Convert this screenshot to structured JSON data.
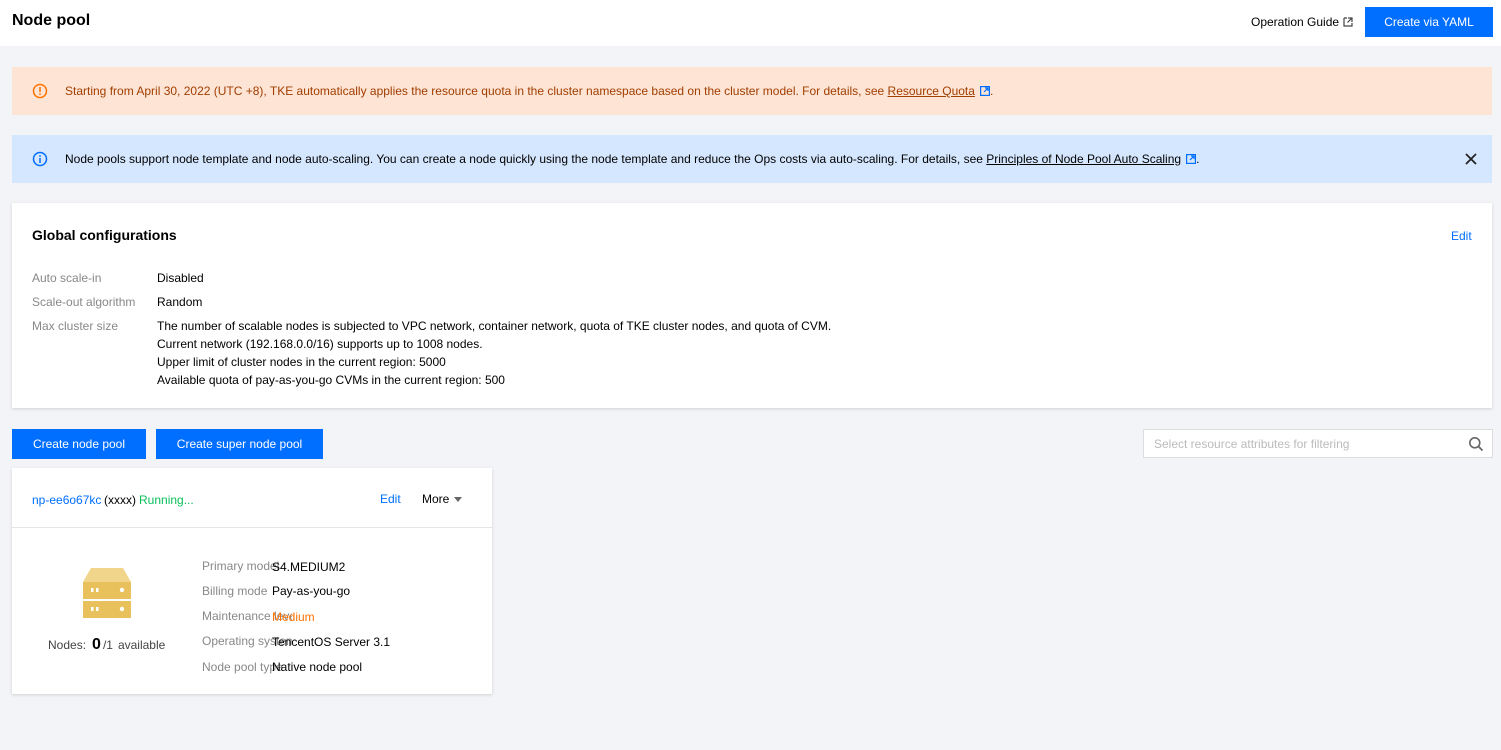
{
  "header": {
    "title": "Node pool",
    "operation_guide": "Operation Guide",
    "create_yaml": "Create via YAML"
  },
  "alerts": {
    "warning": {
      "text": "Starting from April 30, 2022 (UTC +8), TKE automatically applies the resource quota in the cluster namespace based on the cluster model. For details, see ",
      "link": "Resource Quota",
      "suffix": "."
    },
    "info": {
      "text": "Node pools support node template and node auto-scaling. You can create a node quickly using the node template and reduce the Ops costs via auto-scaling. For details, see ",
      "link": "Principles of Node Pool Auto Scaling",
      "suffix": "."
    }
  },
  "global_config": {
    "title": "Global configurations",
    "edit": "Edit",
    "items": [
      {
        "label": "Auto scale-in",
        "value": [
          "Disabled"
        ]
      },
      {
        "label": "Scale-out algorithm",
        "value": [
          "Random"
        ]
      },
      {
        "label": "Max cluster size",
        "value": [
          "The number of scalable nodes is subjected to VPC network, container network, quota of TKE cluster nodes, and quota of CVM.",
          "Current network (192.168.0.0/16) supports up to 1008 nodes.",
          "Upper limit of cluster nodes in the current region: 5000",
          "Available quota of pay-as-you-go CVMs in the current region: 500"
        ]
      }
    ]
  },
  "actions": {
    "create_node_pool": "Create node pool",
    "create_super_node_pool": "Create super node pool",
    "filter_placeholder": "Select resource attributes for filtering"
  },
  "node_pool": {
    "id": "np-ee6o67kc",
    "alias": "(xxxx)",
    "status": "Running...",
    "edit": "Edit",
    "more": "More",
    "nodes_label": "Nodes:",
    "nodes_count": "0",
    "nodes_total": "/1",
    "nodes_suffix": "available",
    "details": [
      {
        "label": "Primary model",
        "value": "S4.MEDIUM2"
      },
      {
        "label": "Billing mode",
        "value": "Pay-as-you-go"
      },
      {
        "label": "Maintenance level",
        "value": "Medium"
      },
      {
        "label": "Operating system",
        "value": "TencentOS Server 3.1"
      },
      {
        "label": "Node pool type",
        "value": "Native node pool"
      }
    ]
  },
  "colors": {
    "primary": "#006eff",
    "running": "#0abf5b",
    "warning_bg": "#fde4d5",
    "info_bg": "#d5e7fe",
    "medium": "#ff7200"
  }
}
